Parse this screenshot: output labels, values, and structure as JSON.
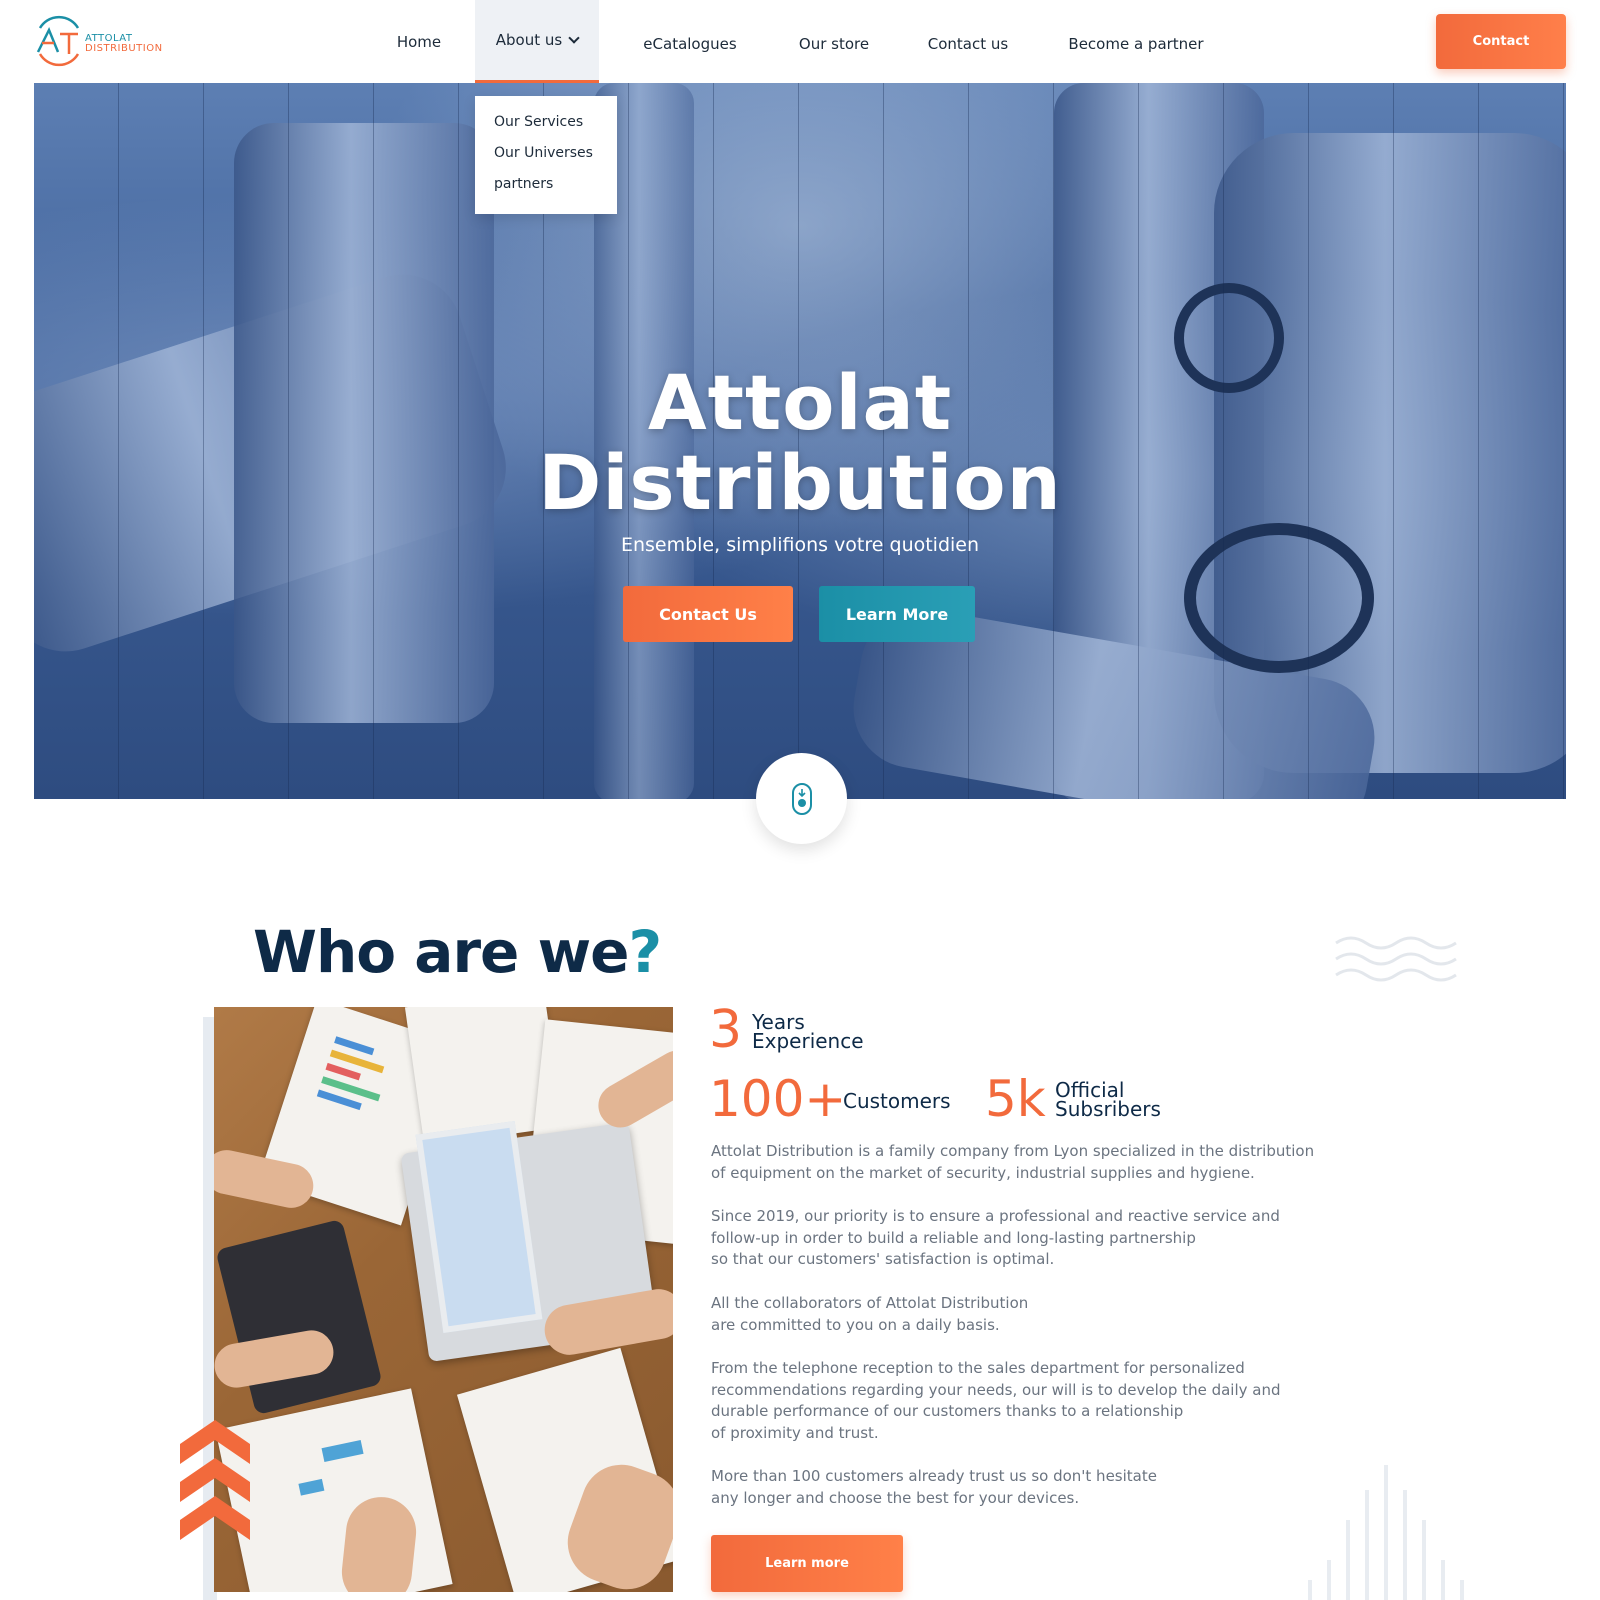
{
  "header": {
    "logo": {
      "line1": "ATTOLAT",
      "line2": "DISTRIBUTION",
      "monogram": "AT"
    },
    "nav": [
      {
        "label": "Home"
      },
      {
        "label": "About us",
        "active": true,
        "has_dropdown": true
      },
      {
        "label": "eCatalogues"
      },
      {
        "label": "Our store"
      },
      {
        "label": "Contact us"
      },
      {
        "label": "Become a partner"
      }
    ],
    "contact_button": "Contact"
  },
  "dropdown": {
    "items": [
      "Our Services",
      "Our Universes",
      "partners"
    ]
  },
  "hero": {
    "title_line1": "Attolat",
    "title_line2": "Distribution",
    "subtitle": "Ensemble, simplifions votre quotidien",
    "primary_button": "Contact Us",
    "secondary_button": "Learn More",
    "scroll_icon": "mouse-scroll-icon"
  },
  "about": {
    "title": "Who are we",
    "title_mark": "?",
    "stats": [
      {
        "value": "3",
        "label_line1": "Years",
        "label_line2": "Experience"
      },
      {
        "value": "100+",
        "label_line1": "Customers",
        "label_line2": ""
      },
      {
        "value": "5k",
        "label_line1": "Official",
        "label_line2": "Subsribers"
      }
    ],
    "paragraphs": [
      [
        "Attolat Distribution is a family company from Lyon specialized in the distribution",
        "of equipment on the market of security, industrial supplies and hygiene."
      ],
      [
        "Since 2019, our priority is to ensure a professional and reactive service and",
        "follow-up in order to build a reliable and long-lasting partnership",
        "so that our customers' satisfaction is optimal."
      ],
      [
        "All the collaborators of Attolat Distribution",
        "are committed to you on a daily basis."
      ],
      [
        "From the telephone reception to the sales department for personalized",
        "recommendations regarding your needs, our will is to develop the daily and",
        "durable performance of our customers thanks to a relationship",
        "of proximity and trust."
      ],
      [
        "More than 100 customers already trust us so don't hesitate",
        "any longer and choose the best for your devices."
      ]
    ],
    "learn_more_button": "Learn more"
  },
  "colors": {
    "accent_orange": "#f26a3c",
    "accent_teal": "#1b8fa6",
    "navy": "#0e2a47",
    "body_text": "#6b7480"
  }
}
